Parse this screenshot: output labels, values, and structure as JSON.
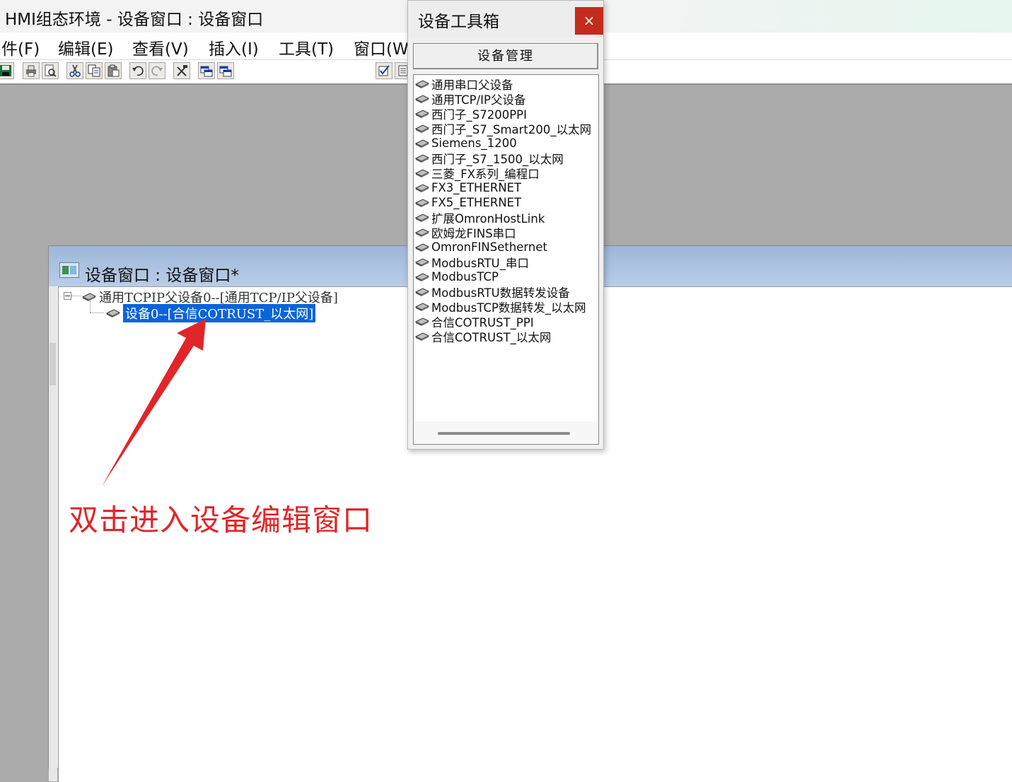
{
  "app": {
    "title": "HMI组态环境 - 设备窗口 : 设备窗口"
  },
  "menu": [
    {
      "label": "件(F)"
    },
    {
      "label": "编辑(E)"
    },
    {
      "label": "查看(V)"
    },
    {
      "label": "插入(I)"
    },
    {
      "label": "工具(T)"
    },
    {
      "label": "窗口(W"
    }
  ],
  "toolbar": {
    "icons": [
      "save-icon",
      "print-icon",
      "print-preview-icon",
      "cut-icon",
      "copy-icon",
      "paste-icon",
      "undo-icon",
      "redo-icon",
      "tools-icon",
      "window-icon",
      "window-icon",
      "check-icon",
      "list-icon"
    ]
  },
  "device_window": {
    "title": "设备窗口 : 设备窗口*",
    "tree": {
      "parent": "通用TCPIP父设备0--[通用TCP/IP父设备]",
      "child": "设备0--[合信COTRUST_以太网]"
    }
  },
  "annotation": {
    "text": "双击进入设备编辑窗口",
    "color": "#e0262a"
  },
  "toolbox": {
    "title": "设备工具箱",
    "close_symbol": "×",
    "manage_button": "设备管理",
    "devices": [
      "通用串口父设备",
      "通用TCP/IP父设备",
      "西门子_S7200PPI",
      "西门子_S7_Smart200_以太网",
      "Siemens_1200",
      "西门子_S7_1500_以太网",
      "三菱_FX系列_编程口",
      "FX3_ETHERNET",
      "FX5_ETHERNET",
      "扩展OmronHostLink",
      "欧姆龙FINS串口",
      "OmronFINSethernet",
      "ModbusRTU_串口",
      "ModbusTCP",
      "ModbusRTU数据转发设备",
      "ModbusTCP数据转发_以太网",
      "合信COTRUST_PPI",
      "合信COTRUST_以太网"
    ]
  },
  "colors": {
    "selection": "#0a64d8",
    "close_button": "#c42b1c",
    "mdi_background": "#ababab"
  }
}
